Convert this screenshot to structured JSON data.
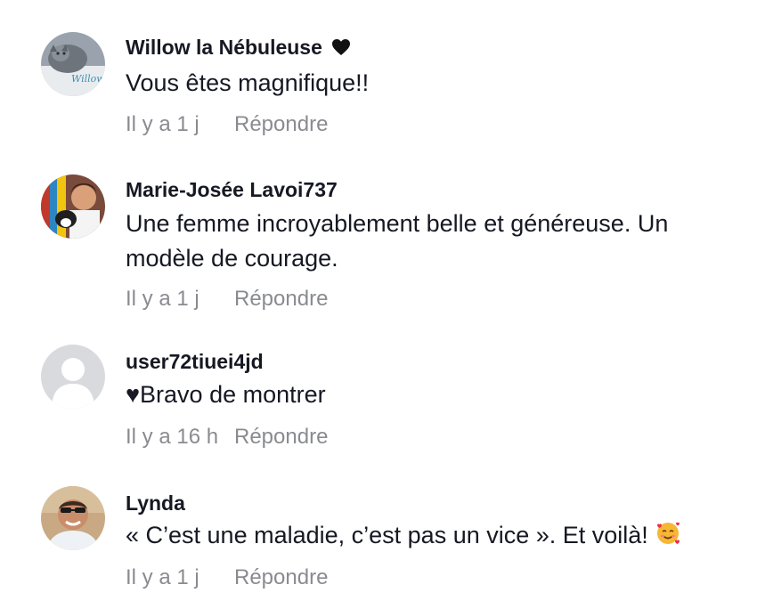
{
  "comments": [
    {
      "username": "Willow la Nébuleuse",
      "badge_icon": "black-heart-icon",
      "avatar_caption": "Willow",
      "text": "Vous êtes magnifique!!",
      "time": "Il y a 1 j",
      "reply": "Répondre"
    },
    {
      "username": "Marie-Josée Lavoi737",
      "text": "Une femme incroyablement belle et généreuse. Un modèle de courage.",
      "time": "Il y a 1 j",
      "reply": "Répondre"
    },
    {
      "username": "user72tiuei4jd",
      "text": "♥Bravo de montrer",
      "time": "Il y a 16 h",
      "reply": "Répondre"
    },
    {
      "username": "Lynda",
      "text": "« C’est une maladie, c’est pas un vice ». Et voilà!",
      "trailing_emoji": "smiling-face-with-hearts-icon",
      "time": "Il y a 1 j",
      "reply": "Répondre"
    }
  ],
  "colors": {
    "username": "#161823",
    "text": "#161823",
    "meta": "#8a8b91",
    "background": "#ffffff"
  }
}
